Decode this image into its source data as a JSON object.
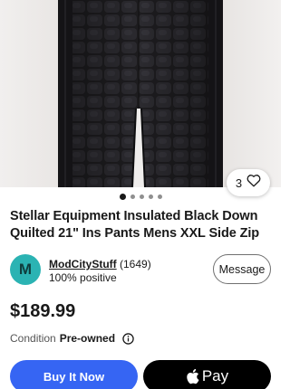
{
  "listing": {
    "title": "Stellar Equipment Insulated Black Down Quilted 21\" Ins Pants Mens XXL Side Zip",
    "price": "$189.99",
    "watch_count": "3",
    "image_count": 5,
    "active_image": 1
  },
  "seller": {
    "avatar_letter": "M",
    "name": "ModCityStuff",
    "feedback_count": "(1649)",
    "positive": "100% positive",
    "message_label": "Message"
  },
  "condition": {
    "label": "Condition",
    "value": "Pre-owned"
  },
  "actions": {
    "buy_now_label": "Buy It Now",
    "apple_pay_label": "Pay"
  },
  "colors": {
    "accent": "#3665f3",
    "avatar_bg": "#2bb3b3",
    "text": "#191919"
  },
  "icons": {
    "like": "heart-icon",
    "info": "info-icon",
    "apple": "apple-logo-icon"
  }
}
